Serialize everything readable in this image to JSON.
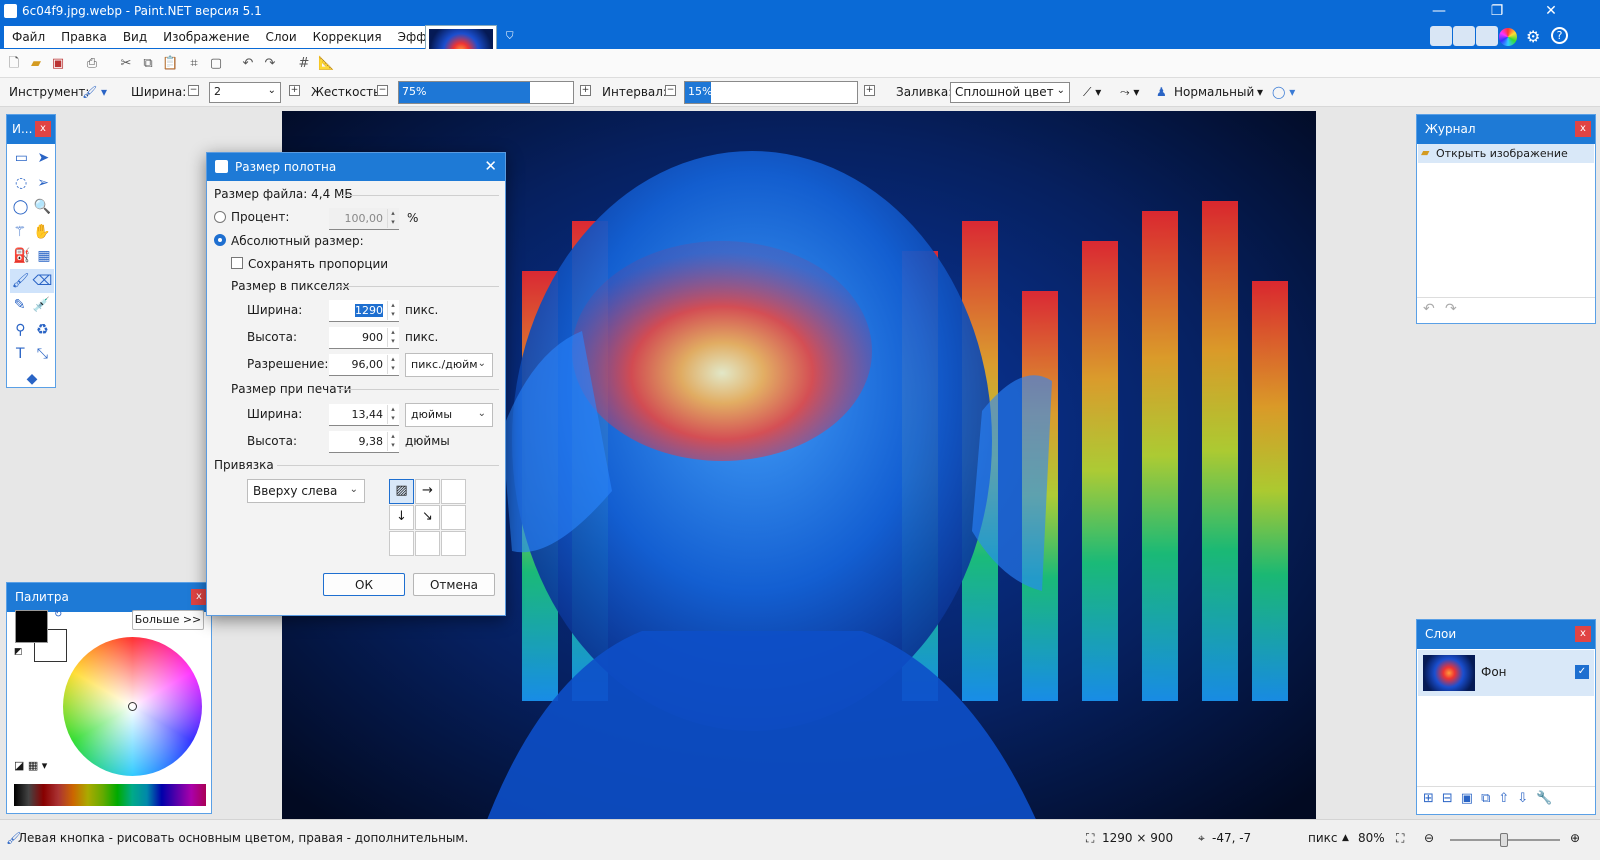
{
  "window": {
    "title": "6c04f9.jpg.webp - Paint.NET версия 5.1",
    "minimize": "—",
    "restore": "❐",
    "close": "✕"
  },
  "menu": {
    "items": [
      "Файл",
      "Правка",
      "Вид",
      "Изображение",
      "Слои",
      "Коррекция",
      "Эффекты"
    ]
  },
  "toolbar2": {
    "tool_label": "Инструмент:",
    "width_label": "Ширина:",
    "width_value": "2",
    "hardness_label": "Жесткость:",
    "hardness_value": "75%",
    "hardness_fraction": 0.75,
    "interval_label": "Интервал:",
    "interval_value": "15%",
    "interval_fraction": 0.15,
    "fill_label": "Заливка:",
    "fill_value": "Сплошной цвет",
    "blend_value": "Нормальный"
  },
  "tools_panel": {
    "title": "И...",
    "close": "x"
  },
  "palette_panel": {
    "title": "Палитра",
    "close": "x",
    "more_button": "Больше >>",
    "primary_color": "#000000",
    "secondary_color": "#ffffff"
  },
  "history_panel": {
    "title": "Журнал",
    "close": "x",
    "items": [
      "Открыть изображение"
    ]
  },
  "layers_panel": {
    "title": "Слои",
    "close": "x",
    "layers": [
      {
        "name": "Фон",
        "visible": true
      }
    ]
  },
  "dialog": {
    "title": "Размер полотна",
    "close": "✕",
    "file_size": "Размер файла: 4,4 МБ",
    "percent_label": "Процент:",
    "percent_value": "100,00",
    "percent_unit": "%",
    "absolute_label": "Абсолютный размер:",
    "keep_ratio_label": "Сохранять пропорции",
    "pixel_size_header": "Размер в пикселях",
    "width_label": "Ширина:",
    "width_value": "1290",
    "width_unit": "пикс.",
    "height_label": "Высота:",
    "height_value": "900",
    "height_unit": "пикс.",
    "resolution_label": "Разрешение:",
    "resolution_value": "96,00",
    "resolution_unit": "пикс./дюйм",
    "print_size_header": "Размер при печати",
    "print_width_label": "Ширина:",
    "print_width_value": "13,44",
    "print_width_unit": "дюймы",
    "print_height_label": "Высота:",
    "print_height_value": "9,38",
    "print_height_unit": "дюймы",
    "anchor_header": "Привязка",
    "anchor_value": "Вверху слева",
    "ok": "ОК",
    "cancel": "Отмена"
  },
  "status": {
    "hint": "Левая кнопка - рисовать основным цветом, правая - дополнительным.",
    "image_size": "1290 × 900",
    "cursor_pos": "-47, -7",
    "units": "пикс",
    "zoom": "80%"
  },
  "colors": {
    "accent": "#1e7ad6",
    "titlebar": "#0a6ad6",
    "close_red": "#e04444"
  }
}
